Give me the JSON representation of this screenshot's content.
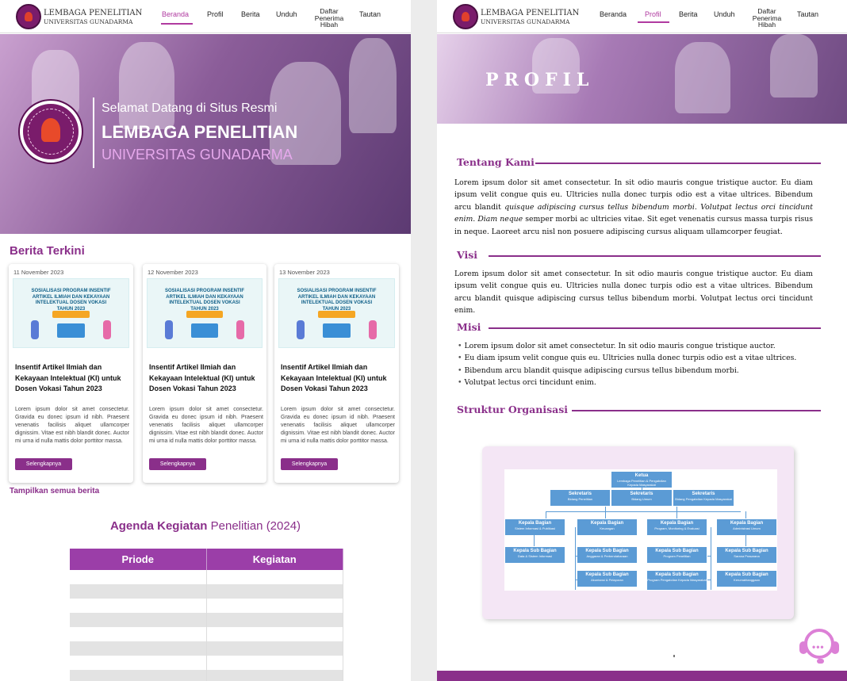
{
  "site": {
    "brand_line1": "LEMBAGA PENELITIAN",
    "brand_line2": "UNIVERSITAS GUNADARMA"
  },
  "nav": {
    "beranda": "Beranda",
    "profil": "Profil",
    "berita": "Berita",
    "unduh": "Unduh",
    "daftar_1": "Daftar",
    "daftar_2": "Penerima",
    "daftar_3": "Hibah",
    "tautan": "Tautan"
  },
  "home": {
    "hero": {
      "greeting": "Selamat Datang di Situs Resmi",
      "title": "LEMBAGA PENELITIAN",
      "subtitle": "UNIVERSITAS GUNADARMA"
    },
    "news_title": "Berita Terkini",
    "news": [
      {
        "date": "11 November 2023",
        "poster": "SOSIALISASI PROGRAM INSENTIF ARTIKEL ILMIAH DAN KEKAYAAN INTELEKTUAL DOSEN VOKASI TAHUN 2023",
        "title": "Insentif Artikel Ilmiah dan Kekayaan Intelektual (KI) untuk Dosen Vokasi Tahun 2023",
        "body": "Lorem ipsum dolor sit amet consectetur. Gravida eu donec ipsum id nibh. Praesent venenatis facilisis aliquet ullamcorper dignissim. Vitae est nibh blandit donec. Auctor mi urna id nulla mattis dolor porttitor massa.",
        "button": "Selengkapnya"
      },
      {
        "date": "12 November 2023",
        "poster": "SOSIALISASI PROGRAM INSENTIF ARTIKEL ILMIAH DAN KEKAYAAN INTELEKTUAL DOSEN VOKASI TAHUN 2023",
        "title": "Insentif Artikel Ilmiah dan Kekayaan Intelektual (KI) untuk Dosen Vokasi Tahun 2023",
        "body": "Lorem ipsum dolor sit amet consectetur. Gravida eu donec ipsum id nibh. Praesent venenatis facilisis aliquet ullamcorper dignissim. Vitae est nibh blandit donec. Auctor mi urna id nulla mattis dolor porttitor massa.",
        "button": "Selengkapnya"
      },
      {
        "date": "13 November 2023",
        "poster": "SOSIALISASI PROGRAM INSENTIF ARTIKEL ILMIAH DAN KEKAYAAN INTELEKTUAL DOSEN VOKASI TAHUN 2023",
        "title": "Insentif Artikel Ilmiah dan Kekayaan Intelektual (KI) untuk Dosen Vokasi Tahun 2023",
        "body": "Lorem ipsum dolor sit amet consectetur. Gravida eu donec ipsum id nibh. Praesent venenatis facilisis aliquet ullamcorper dignissim. Vitae est nibh blandit donec. Auctor mi urna id nulla mattis dolor porttitor massa.",
        "button": "Selengkapnya"
      }
    ],
    "show_all": "Tampilkan semua berita",
    "agenda_bold": "Agenda Kegiatan",
    "agenda_light": "Penelitian (2024)",
    "table_headers": [
      "Priode",
      "Kegiatan"
    ]
  },
  "profil": {
    "hero_title": "PROFIL",
    "about_heading": "Tentang Kami",
    "about_p1": "Lorem ipsum dolor sit amet consectetur. In sit odio mauris congue tristique auctor. Eu diam ipsum velit congue quis eu. Ultricies nulla donec turpis odio est a vitae ultrices. Bibendum arcu blandit",
    "about_italic": "quisque adipiscing cursus tellus bibendum morbi. Volutpat lectus orci tincidunt enim. Diam neque",
    "about_p2": "semper morbi ac ultricies vitae. Sit eget venenatis cursus massa turpis risus in neque. Laoreet arcu nisl non posuere adipiscing cursus aliquam ullamcorper feugiat.",
    "visi_heading": "Visi",
    "visi_text": "Lorem ipsum dolor sit amet consectetur. In sit odio mauris congue tristique auctor. Eu diam ipsum velit congue quis eu. Ultricies nulla donec turpis odio est a vitae ultrices. Bibendum arcu blandit quisque adipiscing cursus tellus bibendum morbi. Volutpat lectus orci tincidunt enim.",
    "misi_heading": "Misi",
    "misi_items": [
      "Lorem ipsum dolor sit amet consectetur. In sit odio mauris congue tristique auctor.",
      "Eu diam ipsum velit congue quis eu. Ultricies nulla donec turpis odio est a vitae ultrices.",
      "Bibendum arcu blandit quisque adipiscing cursus tellus bibendum morbi.",
      "Volutpat lectus orci tincidunt enim."
    ],
    "struktur_heading": "Struktur Organisasi",
    "org": {
      "ketua": {
        "title": "Ketua",
        "sub": "Lembaga Penelitian & Pengabdian Kepada Masyarakat"
      },
      "sek1": {
        "title": "Sekretaris",
        "sub": "Bidang Penelitian"
      },
      "sek2": {
        "title": "Sekretaris",
        "sub": "Bidang Umum"
      },
      "sek3": {
        "title": "Sekretaris",
        "sub": "Bidang Pengabdian Kepada Masyarakat"
      },
      "kb1": {
        "title": "Kepala Bagian",
        "sub": "Sistem Informasi & Publikasi"
      },
      "kb2": {
        "title": "Kepala Bagian",
        "sub": "Keuangan"
      },
      "kb3": {
        "title": "Kepala Bagian",
        "sub": "Program, Monitoring & Evaluasi"
      },
      "kb4": {
        "title": "Kepala Bagian",
        "sub": "Administrasi Umum"
      },
      "ks1": {
        "title": "Kepala Sub Bagian",
        "sub": "Data & Sistem Informasi"
      },
      "ks2": {
        "title": "Kepala Sub Bagian",
        "sub": "Anggaran & Perbendaharaan"
      },
      "ks3": {
        "title": "Kepala Sub Bagian",
        "sub": "Program Penelitian"
      },
      "ks4": {
        "title": "Kepala Sub Bagian",
        "sub": "Sarana Prasarana"
      },
      "ks5": {
        "title": "Kepala Sub Bagian",
        "sub": "Akuntansi & Pelaporan"
      },
      "ks6": {
        "title": "Kepala Sub Bagian",
        "sub": "Program Pengabdian Kepada Masyarakat"
      },
      "ks7": {
        "title": "Kepala Sub Bagian",
        "sub": "Kerumahtanggaan"
      }
    }
  },
  "colors": {
    "accent": "#8a2f8a",
    "active_nav": "#b03aa0",
    "org_box": "#5b9bd5"
  },
  "icons": {
    "support": "customer-support-headset-icon",
    "logo": "university-seal-icon"
  }
}
